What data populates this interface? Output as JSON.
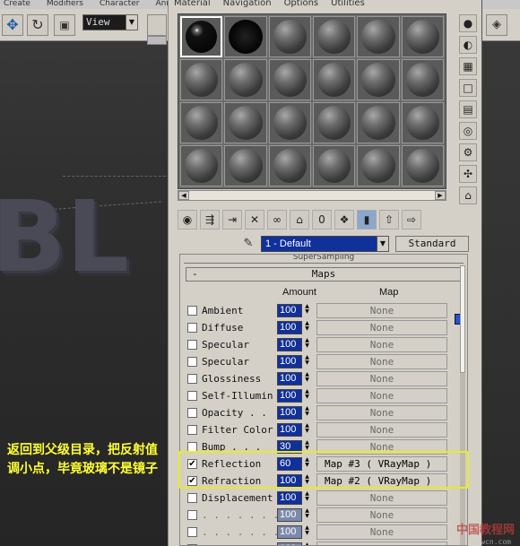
{
  "viewport": {
    "menu": [
      "Create",
      "Modifiers",
      "Character",
      "Anim"
    ],
    "view_label": "View"
  },
  "material_editor": {
    "menu": [
      "Material",
      "Navigation",
      "Options",
      "Utilities"
    ],
    "material_name": "1 - Default",
    "material_type": "Standard",
    "rollout_above": "SuperSampling",
    "maps_header": "Maps",
    "maps_toggle": "-",
    "col_amount": "Amount",
    "col_map": "Map",
    "maps": [
      {
        "label": "Ambient",
        "checked": false,
        "amount": "100",
        "map": "None",
        "disabled": false
      },
      {
        "label": "Diffuse",
        "checked": false,
        "amount": "100",
        "map": "None",
        "disabled": false
      },
      {
        "label": "Specular",
        "checked": false,
        "amount": "100",
        "map": "None",
        "disabled": false
      },
      {
        "label": "Specular",
        "checked": false,
        "amount": "100",
        "map": "None",
        "disabled": false
      },
      {
        "label": "Glossiness",
        "checked": false,
        "amount": "100",
        "map": "None",
        "disabled": false
      },
      {
        "label": "Self-Illumin",
        "checked": false,
        "amount": "100",
        "map": "None",
        "disabled": false
      },
      {
        "label": "Opacity . .",
        "checked": false,
        "amount": "100",
        "map": "None",
        "disabled": false
      },
      {
        "label": "Filter Color",
        "checked": false,
        "amount": "100",
        "map": "None",
        "disabled": false
      },
      {
        "label": "Bump . . .",
        "checked": false,
        "amount": "30",
        "map": "None",
        "disabled": false
      },
      {
        "label": "Reflection",
        "checked": true,
        "amount": "60",
        "map": "Map #3  ( VRayMap )",
        "disabled": false
      },
      {
        "label": "Refraction",
        "checked": true,
        "amount": "100",
        "map": "Map #2  ( VRayMap )",
        "disabled": false
      },
      {
        "label": "Displacement",
        "checked": false,
        "amount": "100",
        "map": "None",
        "disabled": false
      },
      {
        "label": ". . . . . . .",
        "checked": false,
        "amount": "100",
        "map": "None",
        "disabled": true
      },
      {
        "label": ". . . . . . .",
        "checked": false,
        "amount": "100",
        "map": "None",
        "disabled": true
      },
      {
        "label": ". . . . . . .",
        "checked": false,
        "amount": "100",
        "map": "None",
        "disabled": true
      }
    ]
  },
  "caption": "返回到父级目录，把反射值调小点，毕竟玻璃不是镜子",
  "watermark": "中国教程网",
  "watermark_url": "jcwcn.com",
  "colors": {
    "highlight_box": "#eaea22",
    "caption": "#ffff33",
    "amount_field": "#10309a"
  },
  "icons": {
    "slot_side": [
      "sample-type-icon",
      "backlight-icon",
      "background-icon",
      "uv-tiling-icon",
      "video-check-icon",
      "make-preview-icon",
      "options-icon",
      "select-by-material-icon",
      "material-navigator-icon"
    ],
    "bottom_bar": [
      "get-material-icon",
      "put-to-scene-icon",
      "assign-material-icon",
      "reset-map-icon",
      "make-unique-icon",
      "put-to-library-icon",
      "material-effects-channel-icon",
      "show-map-icon",
      "show-end-result-icon",
      "go-to-parent-icon",
      "go-forward-icon"
    ]
  }
}
